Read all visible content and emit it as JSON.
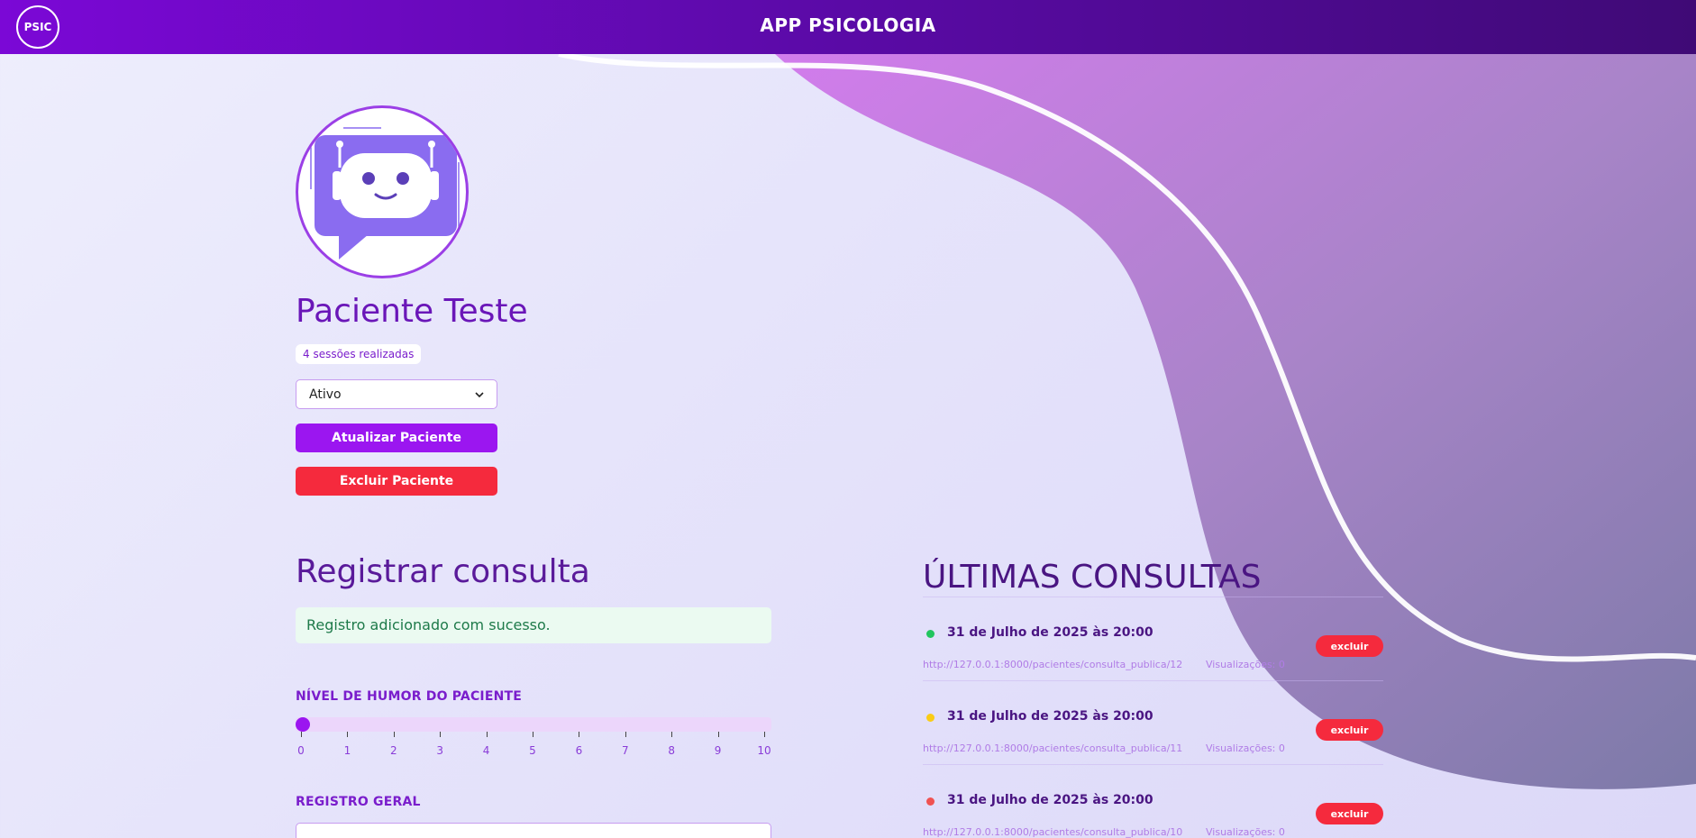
{
  "header": {
    "logo": "PSIC",
    "title": "APP PSICOLOGIA",
    "colors": {
      "gradient_start": "#7b08d6",
      "gradient_end": "#3f0a76"
    }
  },
  "patient": {
    "avatar_icon": "robot-chat-icon",
    "name": "Paciente Teste",
    "sessions": "4 sessões realizadas",
    "status_selected": "Ativo",
    "update_label": "Atualizar Paciente",
    "delete_label": "Excluir Paciente"
  },
  "register": {
    "title": "Registrar consulta",
    "success_message": "Registro adicionado com sucesso.",
    "mood_label": "NÍVEL DE HUMOR DO PACIENTE",
    "mood_value": 0,
    "mood_ticks": [
      "0",
      "1",
      "2",
      "3",
      "4",
      "5",
      "6",
      "7",
      "8",
      "9",
      "10"
    ],
    "general_label": "REGISTRO GERAL"
  },
  "recent": {
    "title": "ÚLTIMAS CONSULTAS",
    "delete_label": "excluir",
    "items": [
      {
        "date": "31 de Julho de 2025 às 20:00",
        "dot_color": "#22c55e",
        "url": "http://127.0.0.1:8000/pacientes/consulta_publica/12",
        "views": "Visualizações: 0"
      },
      {
        "date": "31 de Julho de 2025 às 20:00",
        "dot_color": "#facc15",
        "url": "http://127.0.0.1:8000/pacientes/consulta_publica/11",
        "views": "Visualizações: 0"
      },
      {
        "date": "31 de Julho de 2025 às 20:00",
        "dot_color": "#f05252",
        "url": "http://127.0.0.1:8000/pacientes/consulta_publica/10",
        "views": "Visualizações: 0"
      }
    ]
  }
}
